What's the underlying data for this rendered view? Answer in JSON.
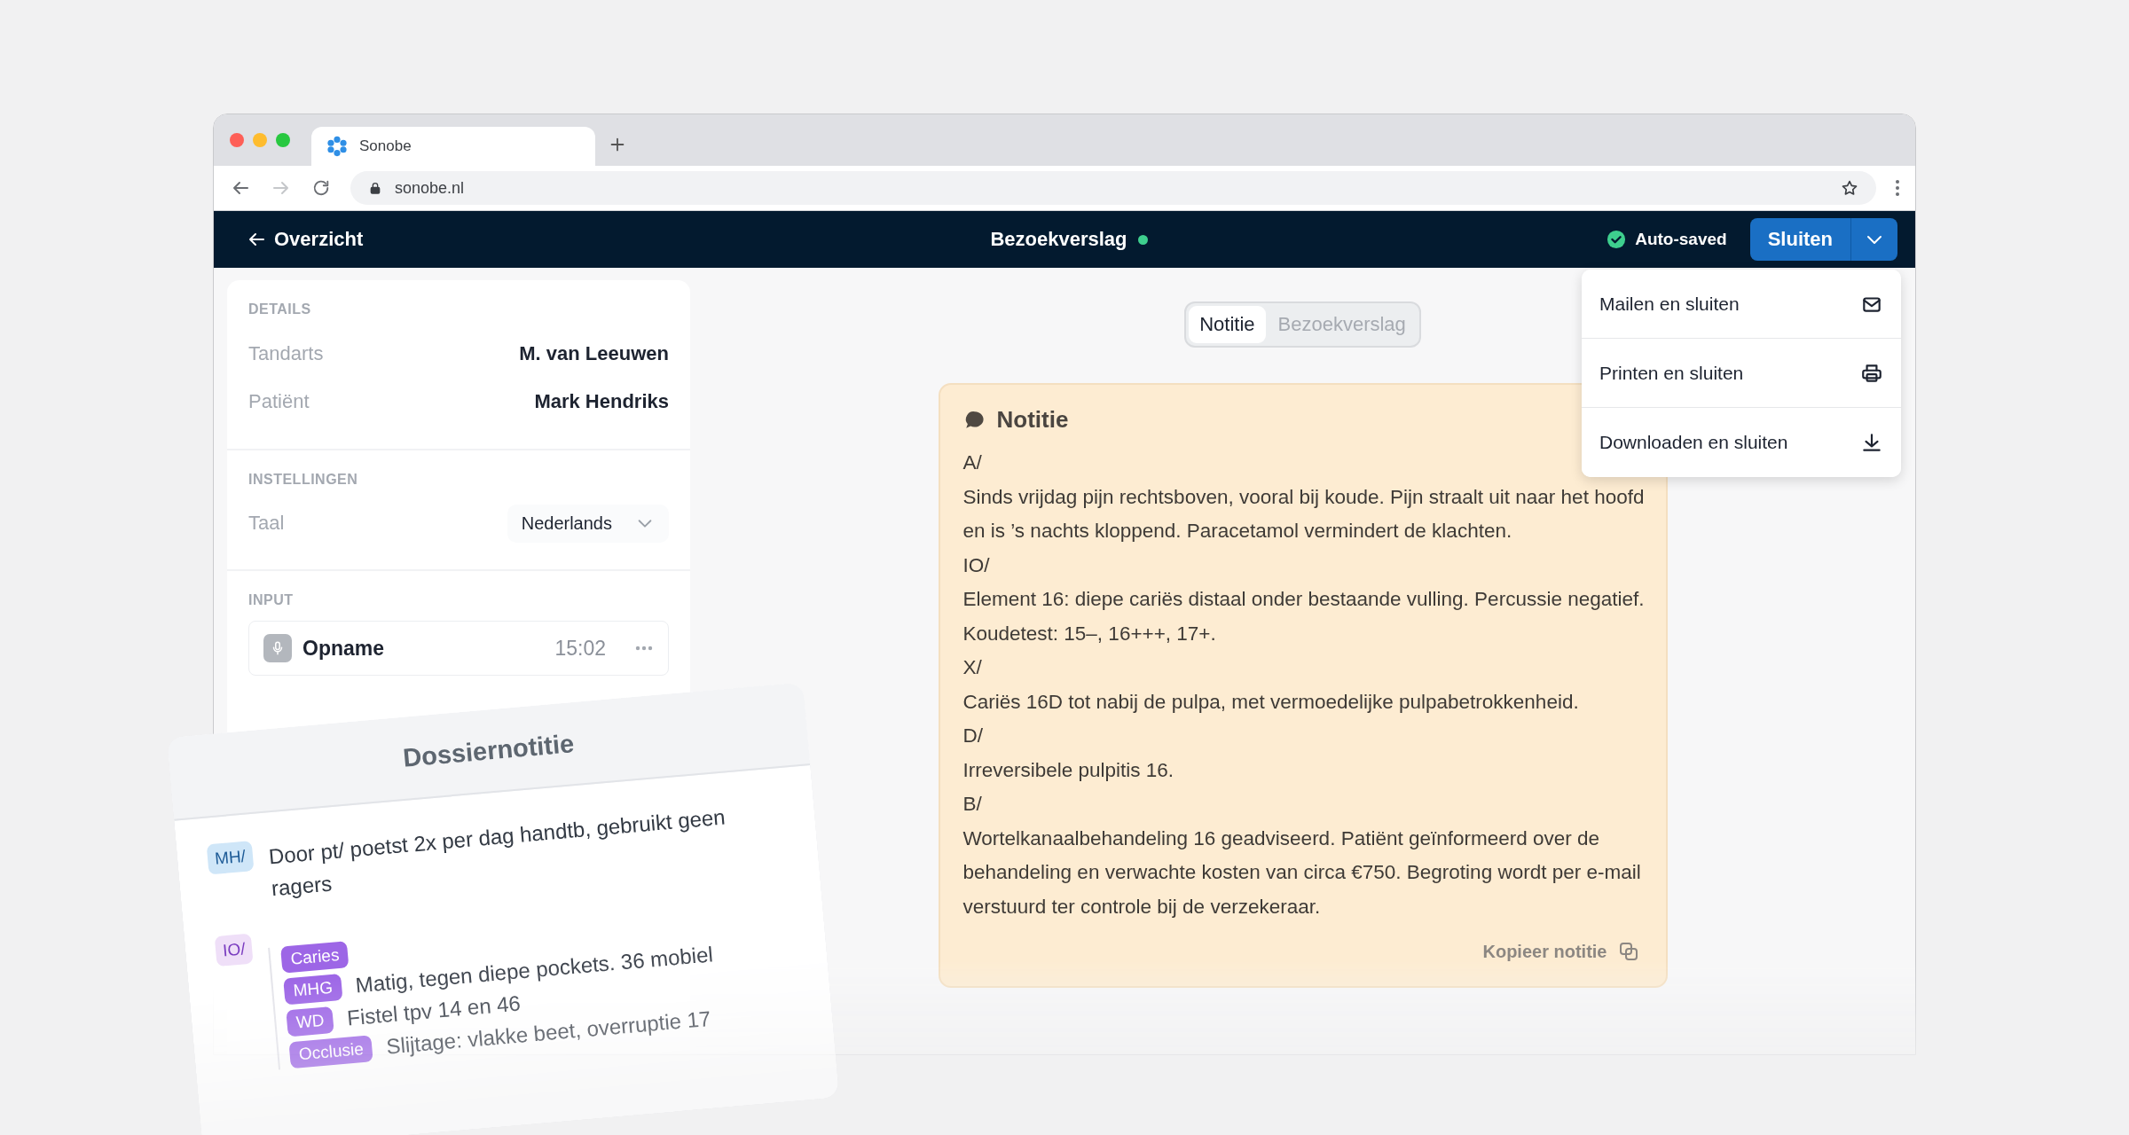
{
  "browser": {
    "tab_title": "Sonobe",
    "address": "sonobe.nl"
  },
  "header": {
    "back_label": "Overzicht",
    "title": "Bezoekverslag",
    "status": "Auto-saved",
    "primary_button": "Sluiten"
  },
  "menu": [
    {
      "label": "Mailen en sluiten",
      "kind": "mail"
    },
    {
      "label": "Printen en sluiten",
      "kind": "print"
    },
    {
      "label": "Downloaden en sluiten",
      "kind": "download"
    }
  ],
  "sidebar": {
    "details": {
      "heading": "DETAILS",
      "rows": [
        {
          "label": "Tandarts",
          "value": "M. van Leeuwen"
        },
        {
          "label": "Patiënt",
          "value": "Mark Hendriks"
        }
      ]
    },
    "settings": {
      "heading": "INSTELLINGEN",
      "label": "Taal",
      "value": "Nederlands"
    },
    "input": {
      "heading": "INPUT",
      "items": [
        {
          "name": "Opname",
          "time": "15:02"
        }
      ]
    }
  },
  "view_tabs": [
    {
      "label": "Notitie",
      "selected": true
    },
    {
      "label": "Bezoekverslag",
      "selected": false
    }
  ],
  "note": {
    "title": "Notitie",
    "lines": [
      "A/",
      "Sinds vrijdag pijn rechtsboven, vooral bij koude. Pijn straalt uit naar het hoofd en is ’s nachts kloppend. Paracetamol vermindert de klachten.",
      "IO/",
      "Element 16: diepe cariës distaal onder bestaande vulling. Percussie negatief. Koudetest: 15–, 16+++, 17+.",
      "X/",
      "Cariës 16D tot nabij de pulpa, met vermoedelijke pulpabetrokkenheid.",
      "D/",
      "Irreversibele pulpitis 16.",
      "B/",
      "Wortelkanaalbehandeling 16 geadviseerd. Patiënt geïnformeerd over de behandeling en verwachte kosten van circa €750. Begroting wordt per e-mail verstuurd ter controle bij de verzekeraar."
    ],
    "copy_label": "Kopieer notitie"
  },
  "dossier": {
    "title": "Dossiernotitie",
    "entries": [
      {
        "code": "MH/",
        "color": "#cfe6f8",
        "text": "Door pt/ poetst 2x per dag handtb, gebruikt geen ragers"
      },
      {
        "code": "IO/",
        "color": "#efdff8",
        "items": [
          {
            "tag": "Caries"
          },
          {
            "tag": "MHG",
            "text": "Matig, tegen diepe pockets. 36 mobiel"
          },
          {
            "tag": "WD",
            "text": "Fistel tpv 14 en 46"
          },
          {
            "tag": "Occlusie",
            "text": "Slijtage: vlakke beet, overruptie 17"
          }
        ]
      }
    ]
  }
}
